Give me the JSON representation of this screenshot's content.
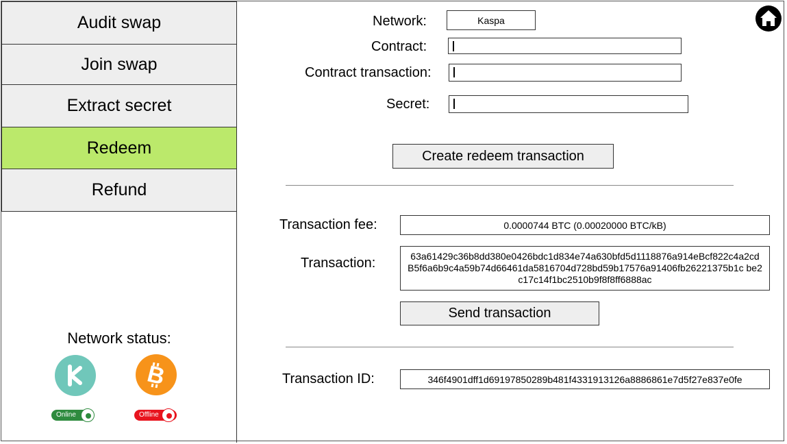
{
  "sidebar": {
    "items": [
      {
        "label": "Audit swap"
      },
      {
        "label": "Join swap"
      },
      {
        "label": "Extract secret"
      },
      {
        "label": "Redeem"
      },
      {
        "label": "Refund"
      }
    ],
    "active_index": 3,
    "active_color": "#bbe96b",
    "network_status": {
      "title": "Network status:",
      "kaspa": {
        "icon": "kaspa-logo-icon",
        "status": "Online",
        "color": "#2e8b3e"
      },
      "bitcoin": {
        "icon": "bitcoin-logo-icon",
        "status": "Offline",
        "color": "#e8141e"
      }
    }
  },
  "form": {
    "network_label": "Network:",
    "network_value": "Kaspa",
    "contract_label": "Contract:",
    "contract_value": "",
    "contract_tx_label": "Contract transaction:",
    "contract_tx_value": "",
    "secret_label": "Secret:",
    "secret_value": "",
    "create_button": "Create redeem transaction"
  },
  "result": {
    "fee_label": "Transaction fee:",
    "fee_value": "0.0000744 BTC (0.00020000 BTC/kB)",
    "tx_label": "Transaction:",
    "tx_value": "63a61429c36b8dd380e0426bdc1d834e74a630bfd5d1118876a914eBcf822c4a2cd B5f6a6b9c4a59b74d66461da5816704d728bd59b17576a91406fb26221375b1c be2c17c14f1bc2510b9f8f8ff6888ac",
    "send_button": "Send transaction",
    "txid_label": "Transaction ID:",
    "txid_value": "346f4901dff1d69197850289b481f4331913126a8886861e7d5f27e837e0fe"
  },
  "header": {
    "home_icon": "home-icon"
  }
}
